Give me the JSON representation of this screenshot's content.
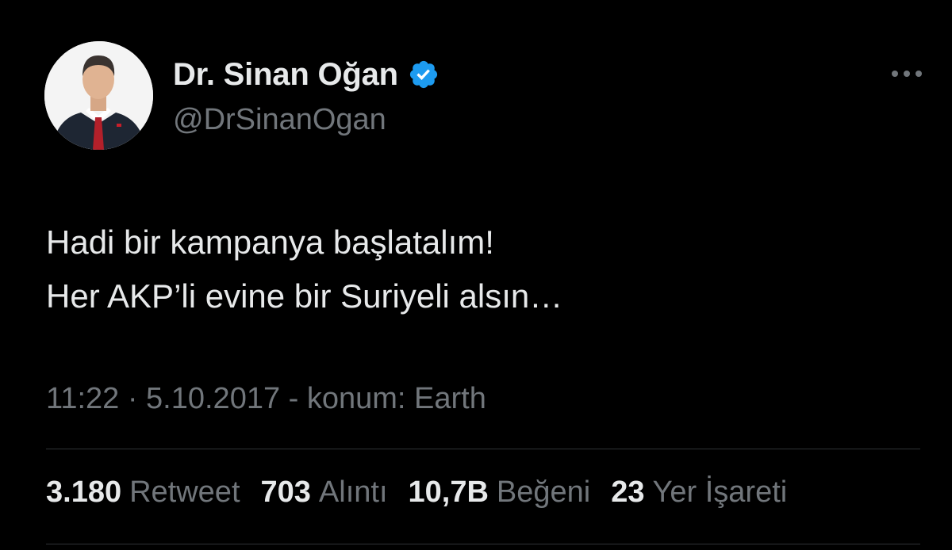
{
  "user": {
    "display_name": "Dr. Sinan Oğan",
    "handle": "@DrSinanOgan",
    "verified": true,
    "verified_color": "#1d9bf0"
  },
  "tweet": {
    "lines": [
      "Hadi bir kampanya başlatalım!",
      "Her AKP’li evine bir Suriyeli alsın…"
    ],
    "meta": "11:22 · 5.10.2017 - konum: Earth"
  },
  "stats": [
    {
      "count": "3.180",
      "label": "Retweet"
    },
    {
      "count": "703",
      "label": "Alıntı"
    },
    {
      "count": "10,7B",
      "label": "Beğeni"
    },
    {
      "count": "23",
      "label": "Yer İşareti"
    }
  ],
  "icons": {
    "more": "more-horizontal-icon",
    "verified": "verified-badge-icon"
  },
  "colors": {
    "background": "#000000",
    "text_primary": "#e7e9ea",
    "text_secondary": "#71767b",
    "divider": "#2f3336"
  }
}
